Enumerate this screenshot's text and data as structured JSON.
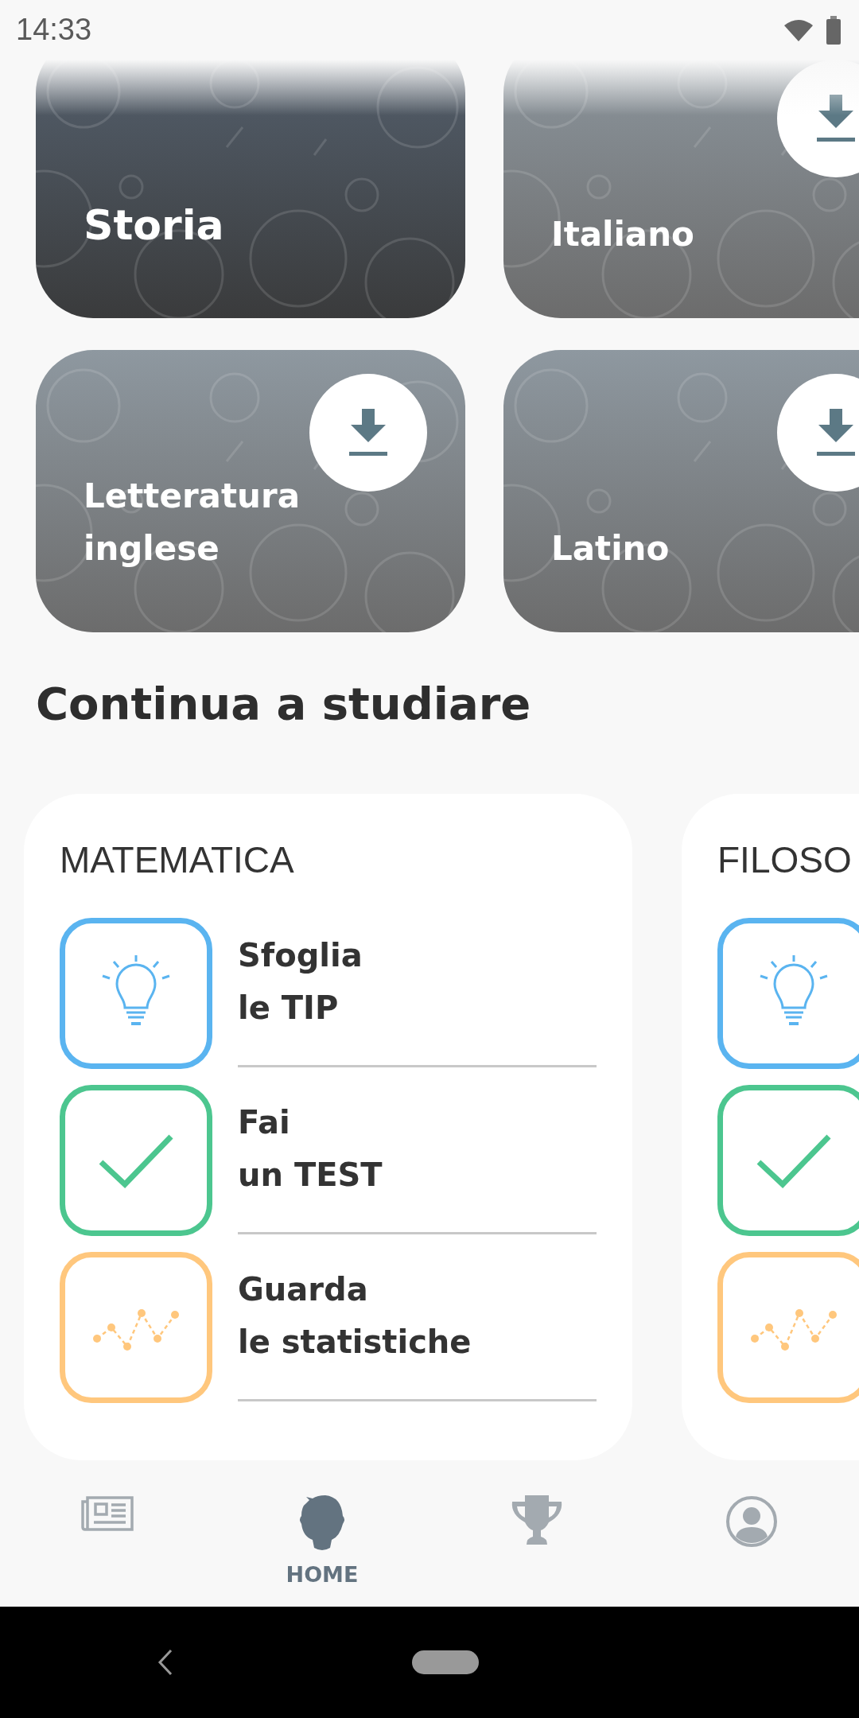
{
  "status_bar": {
    "time": "14:33"
  },
  "subjects": [
    {
      "title": "Storia",
      "downloaded": true
    },
    {
      "title": "Italiano",
      "downloaded": false
    },
    {
      "title": "Letteratura inglese",
      "downloaded": false
    },
    {
      "title": "Latino",
      "downloaded": false
    }
  ],
  "section_title": "Continua a studiare",
  "study_cards": [
    {
      "subject": "MATEMATICA",
      "actions": [
        {
          "kind": "tips",
          "line1": "Sfoglia",
          "line2": "le TIP"
        },
        {
          "kind": "test",
          "line1": "Fai",
          "line2": "un TEST"
        },
        {
          "kind": "stats",
          "line1": "Guarda",
          "line2": "le statistiche"
        }
      ]
    },
    {
      "subject": "FILOSO",
      "actions": [
        {
          "kind": "tips"
        },
        {
          "kind": "test"
        },
        {
          "kind": "stats"
        }
      ]
    }
  ],
  "bottom_nav": [
    {
      "kind": "news",
      "selected": false
    },
    {
      "kind": "home",
      "label": "HOME",
      "selected": true
    },
    {
      "kind": "trophy",
      "selected": false
    },
    {
      "kind": "profile",
      "selected": false
    }
  ]
}
